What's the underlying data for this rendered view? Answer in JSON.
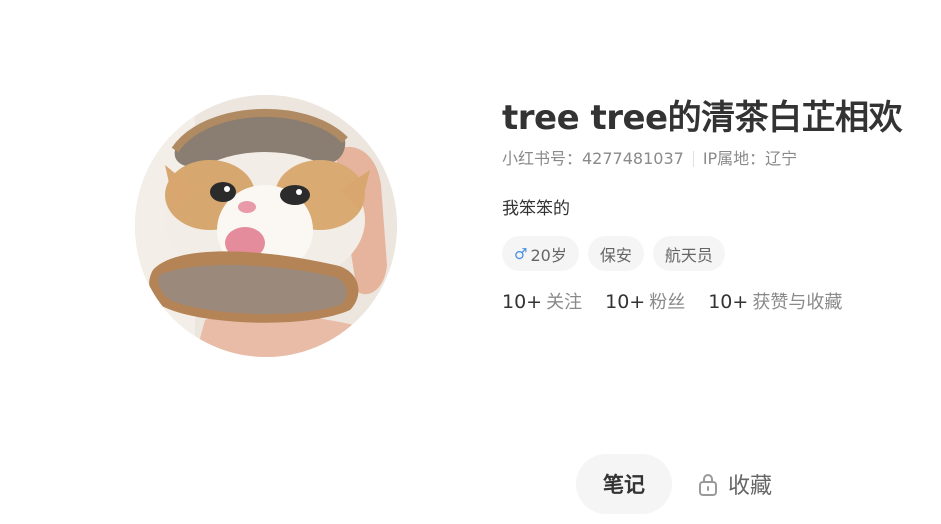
{
  "profile": {
    "nickname": "tree tree的清茶白芷相欢",
    "id_label": "小红书号：4277481037",
    "ip_label": "IP属地：辽宁",
    "description": "我笨笨的",
    "tags": {
      "gender_icon": "male-icon",
      "age": "20岁",
      "location": "保安",
      "occupation": "航天员"
    },
    "stats": {
      "following": {
        "num": "10+",
        "label": "关注"
      },
      "fans": {
        "num": "10+",
        "label": "粉丝"
      },
      "likes": {
        "num": "10+",
        "label": "获赞与收藏"
      }
    }
  },
  "tabs": {
    "notes": "笔记",
    "collections": "收藏"
  },
  "colors": {
    "accent_gender": "#4a90e2",
    "tab_bg": "#f5f5f5"
  }
}
